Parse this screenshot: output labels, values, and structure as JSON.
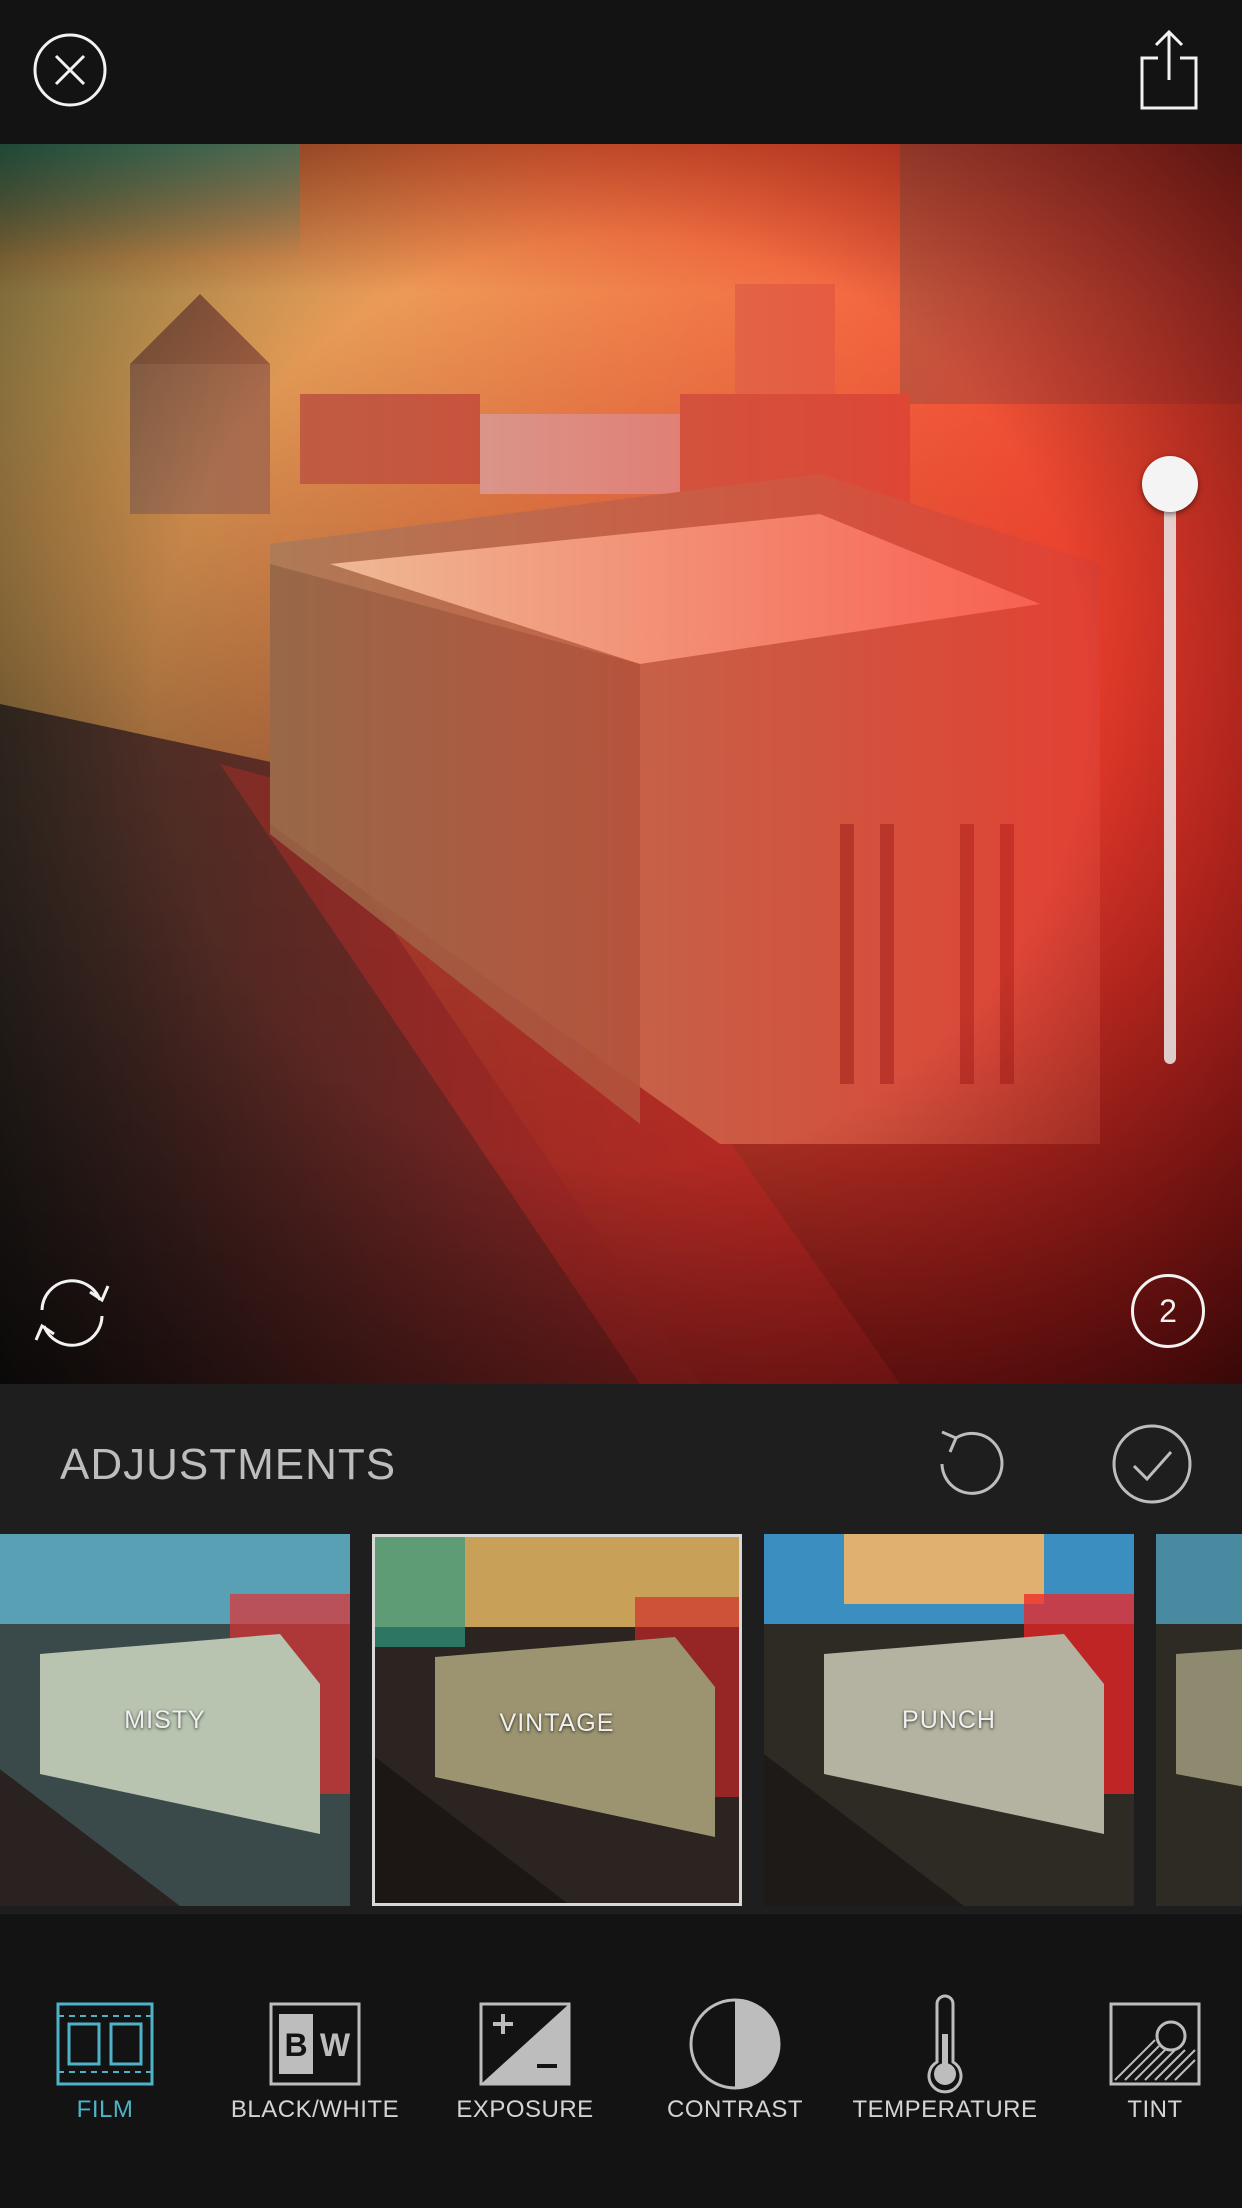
{
  "adjustments": {
    "title": "ADJUSTMENTS"
  },
  "photo": {
    "image_count": "2",
    "intensity_slider_value": 1.0
  },
  "filters": [
    {
      "label": "MISTY",
      "selected": false
    },
    {
      "label": "VINTAGE",
      "selected": true
    },
    {
      "label": "PUNCH",
      "selected": false
    },
    {
      "label": "",
      "selected": false
    }
  ],
  "tools": [
    {
      "label": "FILM",
      "icon": "film-icon",
      "active": true
    },
    {
      "label": "BLACK/WHITE",
      "icon": "black-white-icon",
      "active": false
    },
    {
      "label": "EXPOSURE",
      "icon": "exposure-icon",
      "active": false
    },
    {
      "label": "CONTRAST",
      "icon": "contrast-icon",
      "active": false
    },
    {
      "label": "TEMPERATURE",
      "icon": "thermometer-icon",
      "active": false
    },
    {
      "label": "TINT",
      "icon": "tint-icon",
      "active": false
    }
  ],
  "colors": {
    "background": "#131313",
    "panel": "#1e1e1e",
    "accent": "#4fb3c8"
  }
}
